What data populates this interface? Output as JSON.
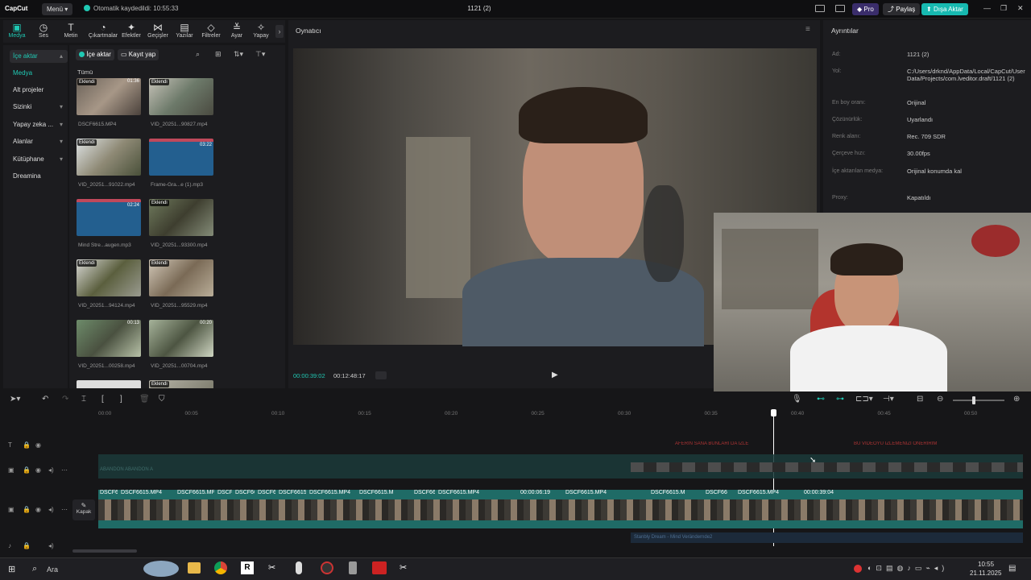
{
  "titlebar": {
    "app_logo": "CapCut",
    "menu_label": "Menü",
    "save_status": "Otomatik kaydedildi: 10:55:33",
    "project_title": "1121 (2)",
    "pro_label": "Pro",
    "share_label": "Paylaş",
    "export_label": "Dışa Aktar"
  },
  "toolbar": {
    "tools": [
      {
        "label": "Medya",
        "icon": "media-icon"
      },
      {
        "label": "Ses",
        "icon": "audio-icon"
      },
      {
        "label": "Metin",
        "icon": "text-icon"
      },
      {
        "label": "Çıkartmalar",
        "icon": "sticker-icon"
      },
      {
        "label": "Efektler",
        "icon": "effects-icon"
      },
      {
        "label": "Geçişler",
        "icon": "transitions-icon"
      },
      {
        "label": "Yazılar",
        "icon": "captions-icon"
      },
      {
        "label": "Filtreler",
        "icon": "filters-icon"
      },
      {
        "label": "Ayar",
        "icon": "adjust-icon"
      },
      {
        "label": "Yapay",
        "icon": "ai-icon"
      }
    ]
  },
  "sidenav": {
    "items": [
      {
        "label": "İçe aktar"
      },
      {
        "label": "Medya"
      },
      {
        "label": "Alt projeler"
      },
      {
        "label": "Sizinki"
      },
      {
        "label": "Yapay zeka ..."
      },
      {
        "label": "Alanlar"
      },
      {
        "label": "Kütüphane"
      },
      {
        "label": "Dreamina"
      }
    ]
  },
  "media": {
    "import_btn": "İçe aktar",
    "record_btn": "Kayıt yap",
    "filter_label": "Tümü",
    "items": [
      {
        "caption": "DSCF6615.MP4",
        "badge": "Eklendi",
        "duration": "01:36"
      },
      {
        "caption": "VID_20251...90827.mp4",
        "badge": "Eklendi",
        "duration": ""
      },
      {
        "caption": "VID_20251...91022.mp4",
        "badge": "Eklendi",
        "duration": ""
      },
      {
        "caption": "Frame-Gra...e (1).mp3",
        "badge": "",
        "duration": "03:22"
      },
      {
        "caption": "Mind Stre...augen.mp3",
        "badge": "",
        "duration": "02:24"
      },
      {
        "caption": "VID_20251...93300.mp4",
        "badge": "Eklendi",
        "duration": ""
      },
      {
        "caption": "VID_20251...94124.mp4",
        "badge": "Eklendi",
        "duration": ""
      },
      {
        "caption": "VID_20251...95529.mp4",
        "badge": "Eklendi",
        "duration": ""
      },
      {
        "caption": "VID_20251...00258.mp4",
        "badge": "",
        "duration": "00:13"
      },
      {
        "caption": "VID_20251...00704.mp4",
        "badge": "",
        "duration": "00:20"
      },
      {
        "caption": "",
        "badge": "",
        "duration": ""
      },
      {
        "caption": "",
        "badge": "Eklendi",
        "duration": ""
      }
    ]
  },
  "player": {
    "title": "Oynatıcı",
    "current_time": "00:00:39:02",
    "total_time": "00:12:48:17"
  },
  "details": {
    "title": "Ayrıntılar",
    "rows": [
      {
        "key": "Ad:",
        "value": "1121 (2)"
      },
      {
        "key": "Yol:",
        "value": "C:/Users/drknd/AppData/Local/CapCut/User Data/Projects/com.lveditor.draft/1121 (2)"
      },
      {
        "key": "En boy oranı:",
        "value": "Orijinal"
      },
      {
        "key": "Çözünürlük:",
        "value": "Uyarlandı"
      },
      {
        "key": "Renk alanı:",
        "value": "Rec. 709 SDR"
      },
      {
        "key": "Çerçeve hızı:",
        "value": "30.00fps"
      },
      {
        "key": "İçe aktarılan medya:",
        "value": "Orijinal konumda kal"
      },
      {
        "key": "Proxy:",
        "value": "Kapatıldı"
      }
    ]
  },
  "timeline": {
    "ruler": [
      "00:00",
      "00:05",
      "00:10",
      "00:15",
      "00:20",
      "00:25",
      "00:30",
      "00:35",
      "00:40",
      "00:45",
      "00:50"
    ],
    "cover_label": "Kapak",
    "main_clips": [
      {
        "label": "DSCF6"
      },
      {
        "label": "DSCF6615.MP4"
      },
      {
        "label": "DSCF6615.MP"
      },
      {
        "label": "DSCF"
      },
      {
        "label": "DSCF66"
      },
      {
        "label": "DSCF6"
      },
      {
        "label": "DSCF6615"
      },
      {
        "label": "DSCF6615.MP4"
      },
      {
        "label": "DSCF6615.M"
      },
      {
        "label": "DSCF66"
      },
      {
        "label": "DSCF6615.MP4"
      },
      {
        "label": "00:00:06:19"
      },
      {
        "label": "DSCF6615.MP4"
      },
      {
        "label": "DSCF6615.M"
      },
      {
        "label": "DSCF66"
      },
      {
        "label": "DSCF6615.MP4"
      },
      {
        "label": "00:00:39:04"
      }
    ],
    "overlay_text_1": "BU VİDEOYU İZLEMENİZİ ÖNERİRİM",
    "overlay_text_2": "AFERİN SANA BUNLARI DA İZLE",
    "audio_label": "ABANDON ABANDON A",
    "bottom_audio": "Stanbly Dream - Mind Verändernde2"
  },
  "taskbar": {
    "search_placeholder": "Ara",
    "time": "10:55",
    "date": "21.11.2025"
  },
  "colors": {
    "accent": "#20c9b4",
    "export_bg": "#17b9b0",
    "pro_bg": "#3a2d6b",
    "main_track": "#1f6b66",
    "audio_wave": "#2a6fa8"
  }
}
